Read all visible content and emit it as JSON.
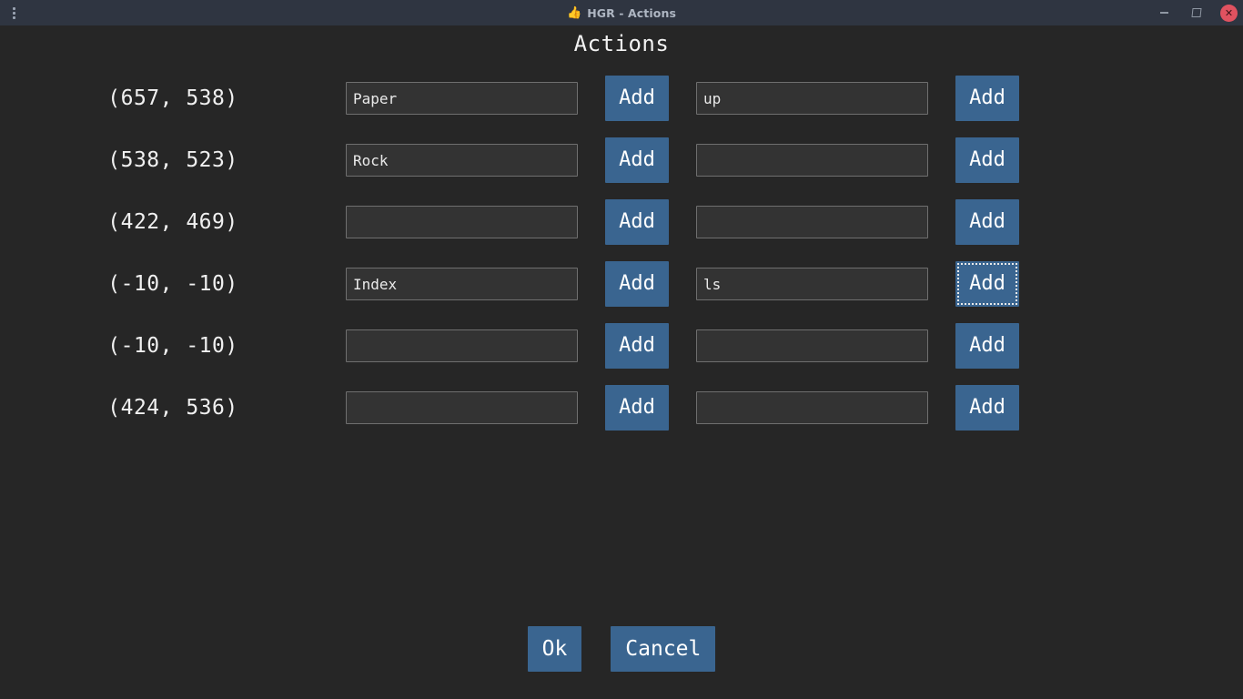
{
  "window": {
    "title": "HGR - Actions",
    "icon": "thumbs-up-emoji",
    "icon_glyph": "👍",
    "menu_icon": "overflow-menu-icon",
    "minimize_label": "",
    "maximize_label": "",
    "close_label": "✕",
    "titlebar_color": "#2f3541",
    "close_color": "#e05260"
  },
  "page": {
    "heading": "Actions",
    "background_color": "#262626",
    "accent_color": "#3a6590"
  },
  "rows": [
    {
      "coord": "(657, 538)",
      "gesture_value": "Paper",
      "gesture_placeholder": "",
      "gesture_add_label": "Add",
      "action_value": "up",
      "action_placeholder": "",
      "action_add_label": "Add",
      "action_add_focused": false
    },
    {
      "coord": "(538, 523)",
      "gesture_value": "Rock",
      "gesture_placeholder": "",
      "gesture_add_label": "Add",
      "action_value": "",
      "action_placeholder": "",
      "action_add_label": "Add",
      "action_add_focused": false
    },
    {
      "coord": "(422, 469)",
      "gesture_value": "",
      "gesture_placeholder": "",
      "gesture_add_label": "Add",
      "action_value": "",
      "action_placeholder": "",
      "action_add_label": "Add",
      "action_add_focused": false
    },
    {
      "coord": "(-10, -10)",
      "gesture_value": "Index",
      "gesture_placeholder": "",
      "gesture_add_label": "Add",
      "action_value": "ls",
      "action_placeholder": "",
      "action_add_label": "Add",
      "action_add_focused": true
    },
    {
      "coord": "(-10, -10)",
      "gesture_value": "",
      "gesture_placeholder": "",
      "gesture_add_label": "Add",
      "action_value": "",
      "action_placeholder": "",
      "action_add_label": "Add",
      "action_add_focused": false
    },
    {
      "coord": "(424, 536)",
      "gesture_value": "",
      "gesture_placeholder": "",
      "gesture_add_label": "Add",
      "action_value": "",
      "action_placeholder": "",
      "action_add_label": "Add",
      "action_add_focused": false
    }
  ],
  "footer": {
    "ok_label": "Ok",
    "cancel_label": "Cancel"
  }
}
